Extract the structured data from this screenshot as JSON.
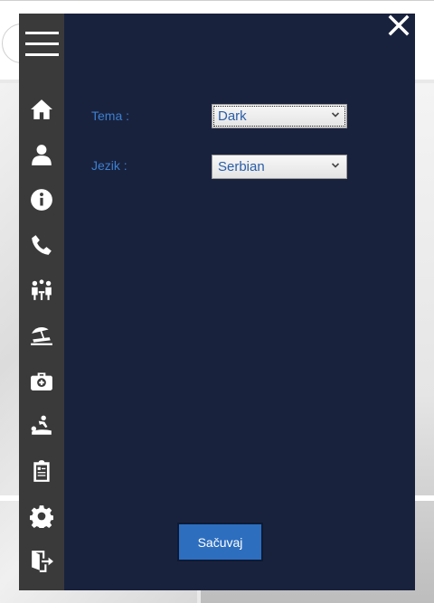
{
  "sidebar": {
    "menu_icon": "hamburger-icon",
    "items": [
      {
        "icon": "home-icon"
      },
      {
        "icon": "user-icon"
      },
      {
        "icon": "info-icon"
      },
      {
        "icon": "phone-icon"
      },
      {
        "icon": "meeting-icon"
      },
      {
        "icon": "beach-icon"
      },
      {
        "icon": "medical-kit-icon"
      },
      {
        "icon": "massage-icon"
      },
      {
        "icon": "clipboard-icon"
      },
      {
        "icon": "gear-icon"
      },
      {
        "icon": "logout-icon"
      }
    ]
  },
  "settings": {
    "theme_label": "Tema :",
    "theme_value": "Dark",
    "language_label": "Jezik :",
    "language_value": "Serbian",
    "save_label": "Sačuvaj"
  },
  "colors": {
    "overlay_bg": "#19223d",
    "sidebar_bg": "#3a3a3a",
    "label_text": "#3c7fd0",
    "button_bg": "#2d6ebf"
  }
}
